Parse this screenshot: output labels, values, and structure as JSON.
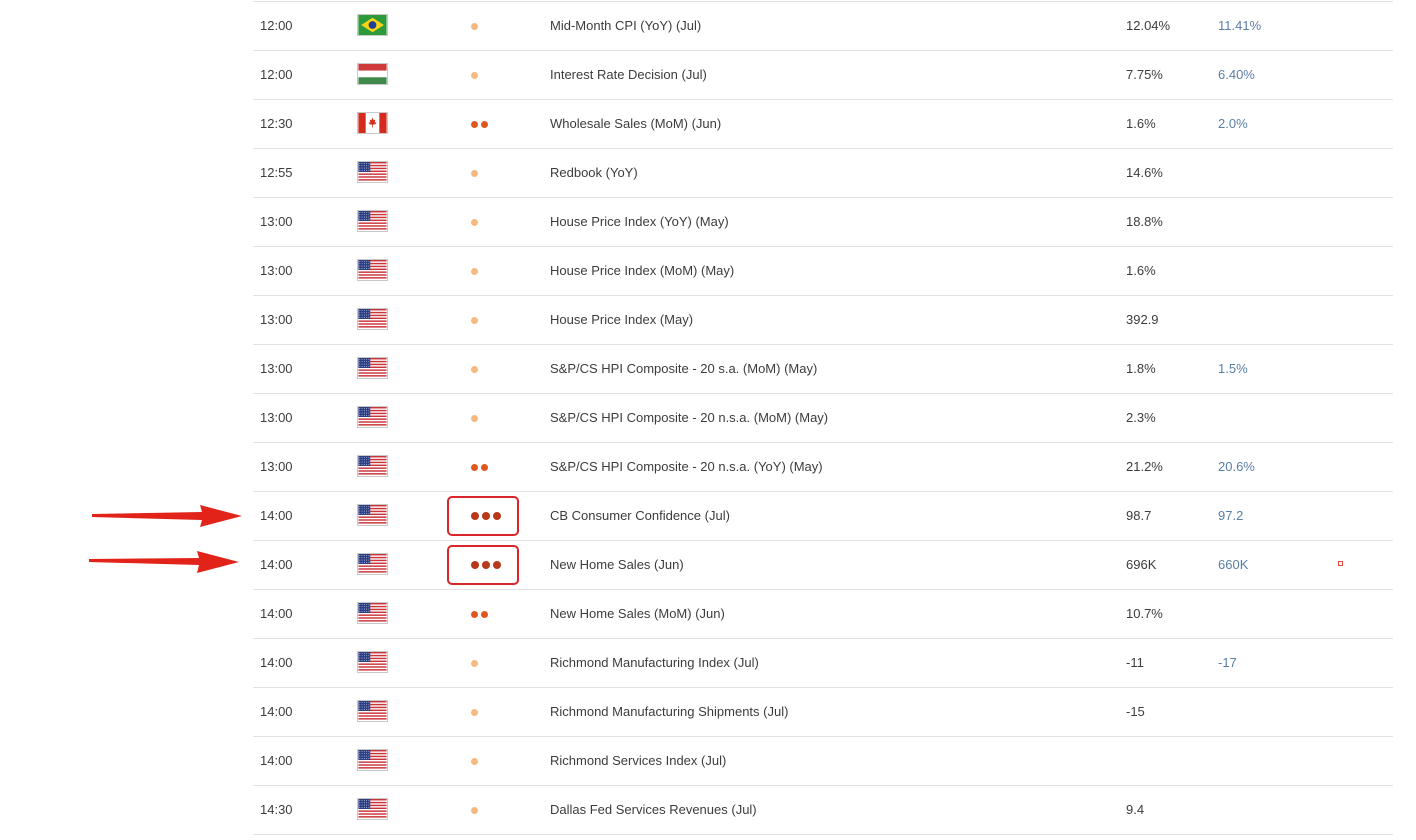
{
  "colors": {
    "importance_low": "#f6b97e",
    "importance_medium": "#e0561f",
    "importance_high": "#b8391a",
    "forecast_text": "#5a7fa5",
    "highlight": "#d8262a"
  },
  "rows": [
    {
      "time": "12:00",
      "flag": "brazil-flag-icon",
      "importance": 1,
      "event": "Mid-Month CPI (YoY) (Jul)",
      "actual": "12.04%",
      "forecast": "11.41%"
    },
    {
      "time": "12:00",
      "flag": "hungary-flag-icon",
      "importance": 1,
      "event": "Interest Rate Decision (Jul)",
      "actual": "7.75%",
      "forecast": "6.40%"
    },
    {
      "time": "12:30",
      "flag": "canada-flag-icon",
      "importance": 2,
      "event": "Wholesale Sales (MoM) (Jun)",
      "actual": "1.6%",
      "forecast": "2.0%"
    },
    {
      "time": "12:55",
      "flag": "usa-flag-icon",
      "importance": 1,
      "event": "Redbook (YoY)",
      "actual": "14.6%",
      "forecast": ""
    },
    {
      "time": "13:00",
      "flag": "usa-flag-icon",
      "importance": 1,
      "event": "House Price Index (YoY) (May)",
      "actual": "18.8%",
      "forecast": ""
    },
    {
      "time": "13:00",
      "flag": "usa-flag-icon",
      "importance": 1,
      "event": "House Price Index (MoM) (May)",
      "actual": "1.6%",
      "forecast": ""
    },
    {
      "time": "13:00",
      "flag": "usa-flag-icon",
      "importance": 1,
      "event": "House Price Index (May)",
      "actual": "392.9",
      "forecast": ""
    },
    {
      "time": "13:00",
      "flag": "usa-flag-icon",
      "importance": 1,
      "event": "S&P/CS HPI Composite - 20 s.a. (MoM) (May)",
      "actual": "1.8%",
      "forecast": "1.5%"
    },
    {
      "time": "13:00",
      "flag": "usa-flag-icon",
      "importance": 1,
      "event": "S&P/CS HPI Composite - 20 n.s.a. (MoM) (May)",
      "actual": "2.3%",
      "forecast": ""
    },
    {
      "time": "13:00",
      "flag": "usa-flag-icon",
      "importance": 2,
      "event": "S&P/CS HPI Composite - 20 n.s.a. (YoY) (May)",
      "actual": "21.2%",
      "forecast": "20.6%"
    },
    {
      "time": "14:00",
      "flag": "usa-flag-icon",
      "importance": 3,
      "event": "CB Consumer Confidence (Jul)",
      "actual": "98.7",
      "forecast": "97.2",
      "highlighted": true
    },
    {
      "time": "14:00",
      "flag": "usa-flag-icon",
      "importance": 3,
      "event": "New Home Sales (Jun)",
      "actual": "696K",
      "forecast": "660K",
      "highlighted": true,
      "marker": true
    },
    {
      "time": "14:00",
      "flag": "usa-flag-icon",
      "importance": 2,
      "event": "New Home Sales (MoM) (Jun)",
      "actual": "10.7%",
      "forecast": ""
    },
    {
      "time": "14:00",
      "flag": "usa-flag-icon",
      "importance": 1,
      "event": "Richmond Manufacturing Index (Jul)",
      "actual": "-11",
      "forecast": "-17"
    },
    {
      "time": "14:00",
      "flag": "usa-flag-icon",
      "importance": 1,
      "event": "Richmond Manufacturing Shipments (Jul)",
      "actual": "-15",
      "forecast": ""
    },
    {
      "time": "14:00",
      "flag": "usa-flag-icon",
      "importance": 1,
      "event": "Richmond Services Index (Jul)",
      "actual": "",
      "forecast": ""
    },
    {
      "time": "14:30",
      "flag": "usa-flag-icon",
      "importance": 1,
      "event": "Dallas Fed Services Revenues (Jul)",
      "actual": "9.4",
      "forecast": ""
    }
  ]
}
